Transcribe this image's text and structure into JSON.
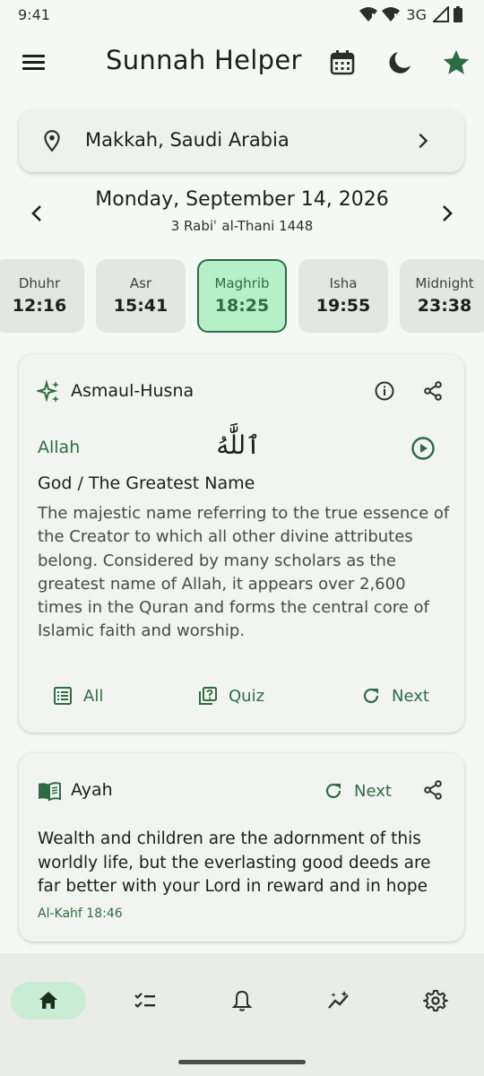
{
  "status_bar": {
    "time": "9:41",
    "network": "3G"
  },
  "app_bar": {
    "title": "Sunnah Helper"
  },
  "location": {
    "label": "Makkah, Saudi Arabia"
  },
  "date": {
    "gregorian": "Monday, September 14, 2026",
    "hijri": "3 Rabiʿ al-Thani 1448"
  },
  "prayers": [
    {
      "name": "Dhuhr",
      "time": "12:16"
    },
    {
      "name": "Asr",
      "time": "15:41"
    },
    {
      "name": "Maghrib",
      "time": "18:25"
    },
    {
      "name": "Isha",
      "time": "19:55"
    },
    {
      "name": "Midnight",
      "time": "23:38"
    }
  ],
  "active_prayer": "Maghrib",
  "names_card": {
    "title": "Asmaul-Husna",
    "transliteration": "Allah",
    "arabic": "ٱللَّٰهُ",
    "meaning": "God / The Greatest Name",
    "description": "The majestic name referring to the true essence of the Creator to which all other divine attributes belong. Considered by many scholars as the greatest name of Allah, it appears over 2,600 times in the Quran and forms the central core of Islamic faith and worship.",
    "actions": {
      "all": "All",
      "quiz": "Quiz",
      "next": "Next"
    }
  },
  "ayah_card": {
    "title": "Ayah",
    "next_label": "Next",
    "text": "Wealth and children are the adornment of this worldly life, but the everlasting good deeds are far better with your Lord in reward and in hope",
    "reference": "Al-Kahf 18:46"
  },
  "bottom_nav": {
    "items": [
      "home-icon",
      "checklist-icon",
      "bell-icon",
      "analytics-icon",
      "settings-icon"
    ],
    "active": "home-icon"
  },
  "colors": {
    "accent": "#2e6b45",
    "active_tile": "#b5f0c9",
    "background": "#f6f8f5"
  }
}
